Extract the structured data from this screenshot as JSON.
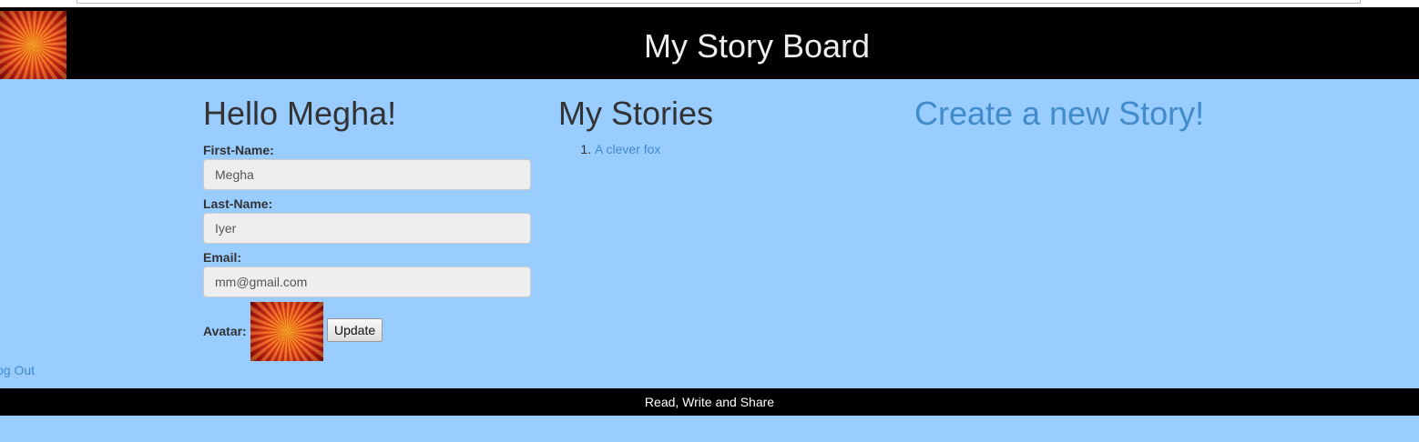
{
  "header": {
    "title": "My Story Board"
  },
  "profile": {
    "greeting": "Hello Megha!",
    "first_name_label": "First-Name:",
    "first_name_value": "Megha",
    "last_name_label": "Last-Name:",
    "last_name_value": "Iyer",
    "email_label": "Email:",
    "email_value": "mm@gmail.com",
    "avatar_label": "Avatar:",
    "update_label": "Update"
  },
  "stories": {
    "heading": "My Stories",
    "items": [
      {
        "number": "1.",
        "title": "A clever fox"
      }
    ]
  },
  "create": {
    "label": "Create a new Story!"
  },
  "logout_label": "og Out",
  "footer": {
    "text": "Read, Write and Share"
  },
  "colors": {
    "page_bg": "#99ccff",
    "header_bg": "#000000",
    "link": "#428bca"
  },
  "icons": {
    "logo": "flower-logo-icon",
    "avatar": "flower-avatar-image"
  }
}
